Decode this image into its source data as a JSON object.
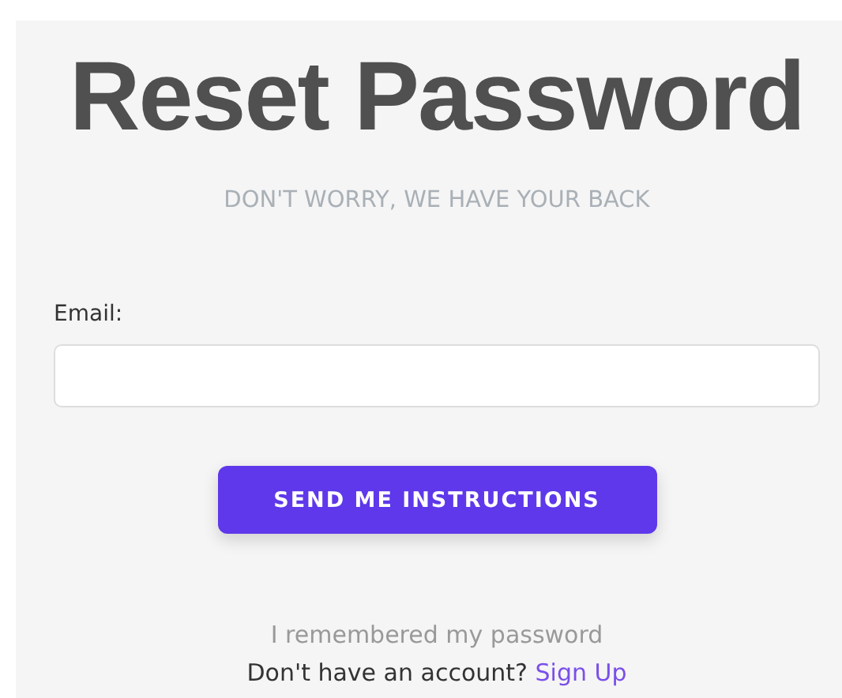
{
  "title": "Reset Password",
  "subtitle": "DON'T WORRY, WE HAVE YOUR BACK",
  "email": {
    "label": "Email:"
  },
  "submit": "SEND ME INSTRUCTIONS",
  "remembered_link": "I remembered my password",
  "signup": {
    "prompt": "Don't have an account?",
    "link": "Sign Up"
  }
}
